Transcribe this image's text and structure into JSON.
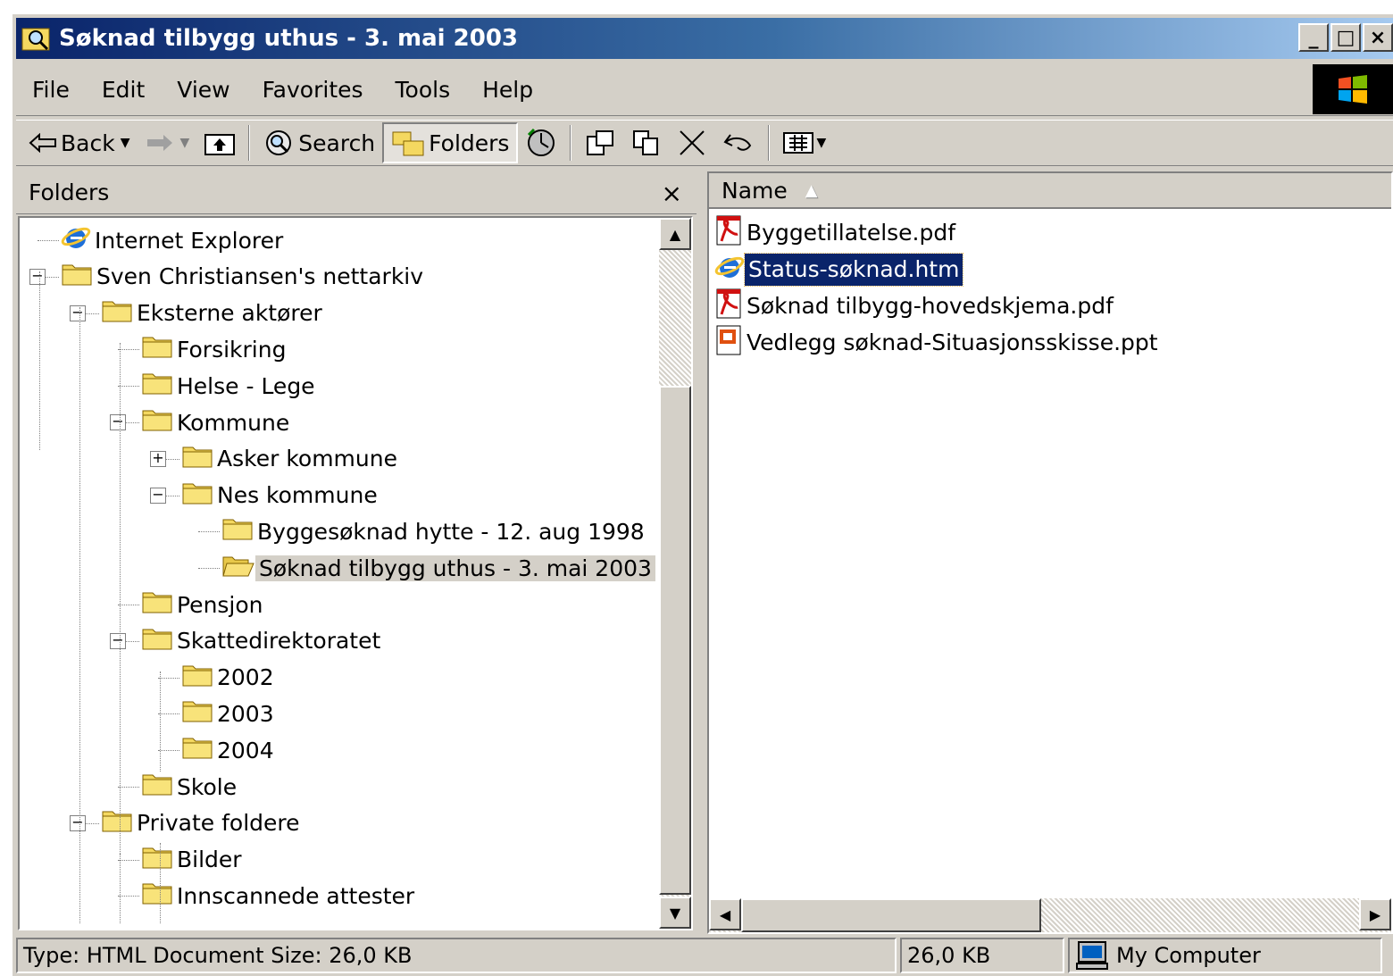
{
  "window": {
    "title": "Søknad tilbygg uthus - 3. mai 2003",
    "minimize": "_",
    "maximize": "□",
    "close": "×"
  },
  "menu": {
    "items": [
      {
        "label": "File"
      },
      {
        "label": "Edit"
      },
      {
        "label": "View"
      },
      {
        "label": "Favorites"
      },
      {
        "label": "Tools"
      },
      {
        "label": "Help"
      }
    ]
  },
  "toolbar": {
    "back_label": "Back",
    "search_label": "Search",
    "folders_label": "Folders"
  },
  "folders_panel": {
    "title": "Folders",
    "close": "×",
    "tree": [
      {
        "label": "Internet Explorer",
        "icon": "ie-icon"
      },
      {
        "label": "Sven Christiansen's nettarkiv",
        "icon": "folder-icon"
      },
      {
        "label": "Eksterne aktører",
        "icon": "folder-icon"
      },
      {
        "label": "Forsikring",
        "icon": "folder-icon"
      },
      {
        "label": "Helse - Lege",
        "icon": "folder-icon"
      },
      {
        "label": "Kommune",
        "icon": "folder-icon"
      },
      {
        "label": "Asker kommune",
        "icon": "folder-icon"
      },
      {
        "label": "Nes kommune",
        "icon": "folder-icon"
      },
      {
        "label": "Byggesøknad hytte - 12. aug 1998",
        "icon": "folder-icon"
      },
      {
        "label": "Søknad tilbygg uthus - 3. mai 2003",
        "icon": "open-folder-icon",
        "selected": true
      },
      {
        "label": "Pensjon",
        "icon": "folder-icon"
      },
      {
        "label": "Skattedirektoratet",
        "icon": "folder-icon"
      },
      {
        "label": "2002",
        "icon": "folder-icon"
      },
      {
        "label": "2003",
        "icon": "folder-icon"
      },
      {
        "label": "2004",
        "icon": "folder-icon"
      },
      {
        "label": "Skole",
        "icon": "folder-icon"
      },
      {
        "label": "Private foldere",
        "icon": "folder-icon"
      },
      {
        "label": "Bilder",
        "icon": "folder-icon"
      },
      {
        "label": "Innscannede attester",
        "icon": "folder-icon"
      }
    ]
  },
  "file_list": {
    "column_name": "Name",
    "files": [
      {
        "name": "Byggetillatelse.pdf",
        "icon": "pdf-icon"
      },
      {
        "name": "Status-søknad.htm",
        "icon": "ie-icon",
        "selected": true
      },
      {
        "name": "Søknad tilbygg-hovedskjema.pdf",
        "icon": "pdf-icon"
      },
      {
        "name": "Vedlegg søknad-Situasjonsskisse.ppt",
        "icon": "ppt-icon"
      }
    ]
  },
  "status": {
    "info": "Type: HTML Document Size: 26,0 KB",
    "size": "26,0 KB",
    "zone": "My Computer"
  },
  "colors": {
    "title_start": "#0a246a",
    "title_end": "#a6caf0",
    "selection": "#0a246a",
    "chrome": "#d4d0c8"
  }
}
